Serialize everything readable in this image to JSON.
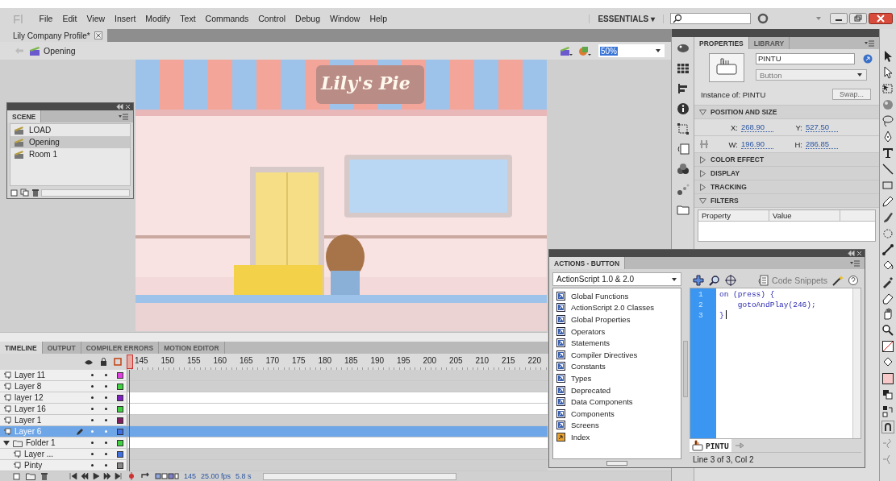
{
  "menu_bar": {
    "logo": "Fl",
    "items": [
      "File",
      "Edit",
      "View",
      "Insert",
      "Modify",
      "Text",
      "Commands",
      "Control",
      "Debug",
      "Window",
      "Help"
    ],
    "workspace": "ESSENTIALS ▾"
  },
  "document_tab": {
    "title": "Lily Company Profile*"
  },
  "edit_bar": {
    "scene": "Opening",
    "zoom": "50%"
  },
  "stage": {
    "sign": "Lily's Pie"
  },
  "scene_panel": {
    "title": "SCENE",
    "scenes": [
      {
        "name": "LOAD",
        "selected": false
      },
      {
        "name": "Opening",
        "selected": true
      },
      {
        "name": "Room 1",
        "selected": false
      }
    ]
  },
  "timeline": {
    "tabs": [
      {
        "label": "TIMELINE",
        "selected": true
      },
      {
        "label": "OUTPUT",
        "selected": false
      },
      {
        "label": "COMPILER ERRORS",
        "selected": false
      },
      {
        "label": "MOTION EDITOR",
        "selected": false
      }
    ],
    "frame_ticks": [
      "145",
      "150",
      "155",
      "160",
      "165",
      "170",
      "175",
      "180",
      "185",
      "190",
      "195",
      "200",
      "205",
      "210",
      "215",
      "220"
    ],
    "layers": [
      {
        "kind": "layer",
        "name": "Layer 11",
        "color": "#e040e0",
        "filled": true,
        "selected": false
      },
      {
        "kind": "layer",
        "name": "Layer 8",
        "color": "#40d040",
        "filled": true,
        "selected": false
      },
      {
        "kind": "layer",
        "name": "layer 12",
        "color": "#8020c0",
        "filled": false,
        "selected": false
      },
      {
        "kind": "layer",
        "name": "Layer 16",
        "color": "#40d040",
        "filled": false,
        "selected": false
      },
      {
        "kind": "layer",
        "name": "Layer 1",
        "color": "#802060",
        "filled": true,
        "selected": false
      },
      {
        "kind": "layer",
        "name": "Layer 6",
        "color": "#4070e0",
        "filled": true,
        "selected": true
      },
      {
        "kind": "folder",
        "name": "Folder 1",
        "color": "#40d040",
        "filled": false,
        "selected": false,
        "expanded": true,
        "children": [
          {
            "kind": "layer",
            "name": "Layer ...",
            "color": "#4070e0",
            "filled": true,
            "selected": false
          },
          {
            "kind": "layer",
            "name": "Pinty",
            "color": "#888888",
            "filled": true,
            "selected": false
          }
        ]
      }
    ],
    "current_frame": "145",
    "fps": "25.00 fps",
    "elapsed": "5.8 s"
  },
  "properties": {
    "tabs": [
      {
        "label": "PROPERTIES",
        "selected": true
      },
      {
        "label": "LIBRARY",
        "selected": false
      }
    ],
    "instance_name": "PINTU",
    "instance_type": "Button",
    "instance_of": "Instance of: PINTU",
    "swap_button": "Swap...",
    "sections": [
      {
        "title": "POSITION AND SIZE",
        "expanded": true,
        "kind": "position"
      },
      {
        "title": "COLOR EFFECT",
        "expanded": false
      },
      {
        "title": "DISPLAY",
        "expanded": false
      },
      {
        "title": "TRACKING",
        "expanded": false
      },
      {
        "title": "FILTERS",
        "expanded": true,
        "kind": "filters"
      }
    ],
    "position": [
      {
        "label": "X:",
        "value": "268.90"
      },
      {
        "label": "Y:",
        "value": "527.50"
      },
      {
        "label": "W:",
        "value": "196.90"
      },
      {
        "label": "H:",
        "value": "286.85"
      }
    ],
    "filter_columns": [
      "Property",
      "Value"
    ]
  },
  "actions_panel": {
    "title": "ACTIONS - BUTTON",
    "language": "ActionScript 1.0 & 2.0",
    "toolbox": [
      {
        "kind": "book",
        "label": "Global Functions"
      },
      {
        "kind": "book",
        "label": "ActionScript 2.0 Classes"
      },
      {
        "kind": "book",
        "label": "Global Properties"
      },
      {
        "kind": "book",
        "label": "Operators"
      },
      {
        "kind": "book",
        "label": "Statements"
      },
      {
        "kind": "book",
        "label": "Compiler Directives"
      },
      {
        "kind": "book",
        "label": "Constants"
      },
      {
        "kind": "book",
        "label": "Types"
      },
      {
        "kind": "book",
        "label": "Deprecated"
      },
      {
        "kind": "book",
        "label": "Data Components"
      },
      {
        "kind": "book",
        "label": "Components"
      },
      {
        "kind": "book",
        "label": "Screens"
      },
      {
        "kind": "index",
        "label": "Index"
      }
    ],
    "code_snippets": "Code Snippets",
    "code": [
      {
        "number": "1",
        "text": "on (press) {"
      },
      {
        "number": "2",
        "text": "    gotoAndPlay(246);"
      },
      {
        "number": "3",
        "text": "}"
      }
    ],
    "script_tab": "PINTU",
    "status": "Line 3 of 3, Col 2"
  }
}
